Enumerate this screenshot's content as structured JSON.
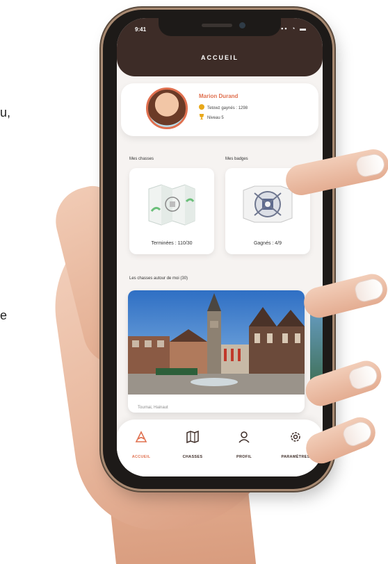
{
  "edge_fragments": [
    "u,",
    "e"
  ],
  "status_bar": {
    "time": "9:41",
    "icons": "▪▪ ◔ ▬"
  },
  "header": {
    "title": "ACCUEIL"
  },
  "profile": {
    "name": "Marion Durand",
    "points": "Tetowz gaynés : 1298",
    "level": "Niveau 5"
  },
  "sections": {
    "hunts": "Mes chasses",
    "badges": "Mes badges",
    "nearby": "Les chasses autour de moi (30)"
  },
  "tiles": {
    "hunts_caption": "Terminées : 110/30",
    "badges_caption": "Gagnés : 4/9"
  },
  "nearby_card": {
    "location": "Tournai, Hainaut"
  },
  "nav": [
    {
      "label": "ACCUEIL",
      "icon": "home-icon",
      "active": true
    },
    {
      "label": "CHASSES",
      "icon": "map-icon",
      "active": false
    },
    {
      "label": "PROFIL",
      "icon": "user-icon",
      "active": false
    },
    {
      "label": "PARAMÈTRES",
      "icon": "gear-icon",
      "active": false
    }
  ],
  "colors": {
    "accent": "#e0704f",
    "header": "#3d2c27",
    "background": "#f6f3f1"
  }
}
